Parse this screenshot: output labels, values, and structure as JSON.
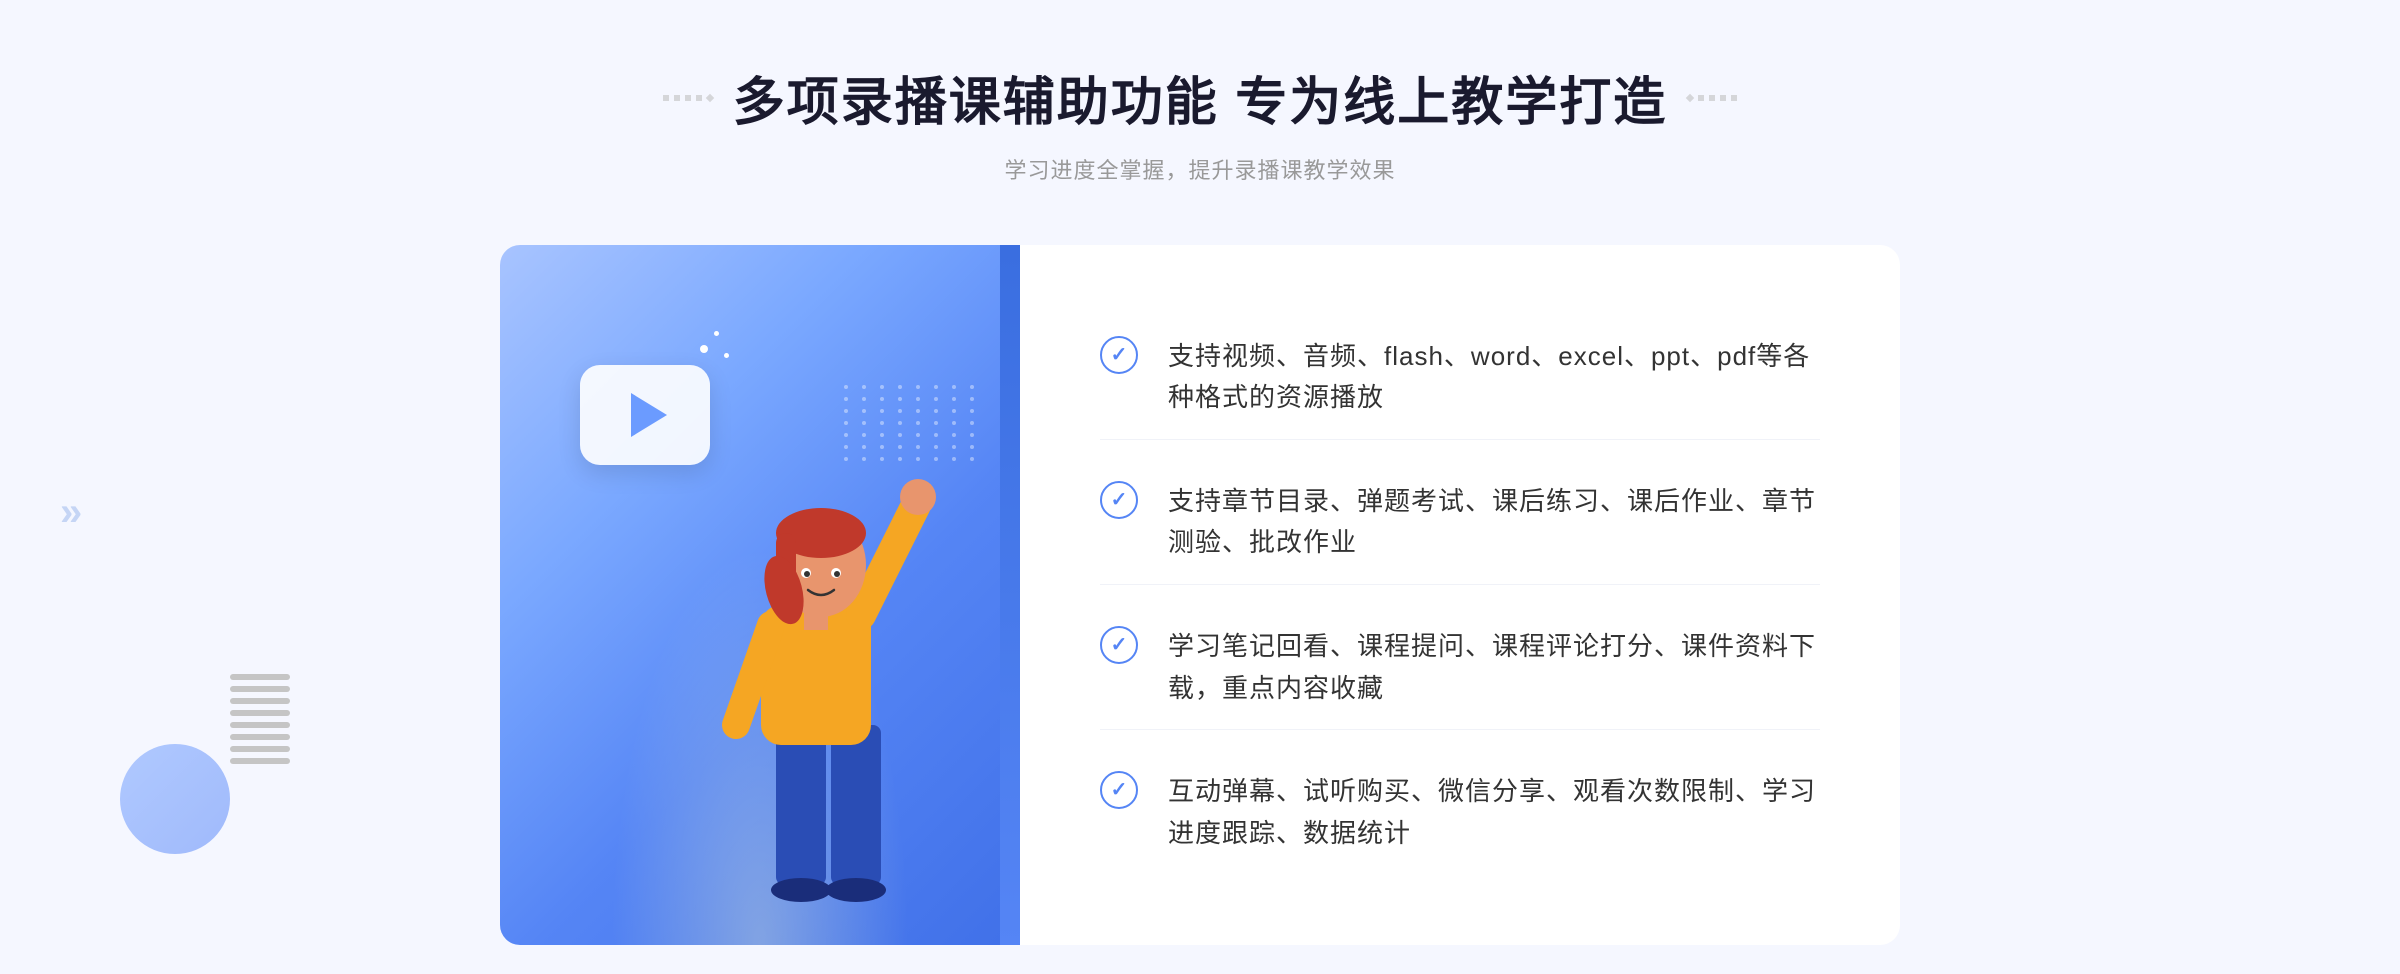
{
  "header": {
    "title": "多项录播课辅助功能 专为线上教学打造",
    "subtitle": "学习进度全掌握，提升录播课教学效果",
    "deco_left": "⁚",
    "deco_right": "⁚"
  },
  "features": [
    {
      "id": "feature-1",
      "text": "支持视频、音频、flash、word、excel、ppt、pdf等各种格式的资源播放"
    },
    {
      "id": "feature-2",
      "text": "支持章节目录、弹题考试、课后练习、课后作业、章节测验、批改作业"
    },
    {
      "id": "feature-3",
      "text": "学习笔记回看、课程提问、课程评论打分、课件资料下载，重点内容收藏"
    },
    {
      "id": "feature-4",
      "text": "互动弹幕、试听购买、微信分享、观看次数限制、学习进度跟踪、数据统计"
    }
  ],
  "colors": {
    "primary": "#5585f5",
    "light_blue": "#a8c4ff",
    "text_dark": "#1a1a2e",
    "text_sub": "#999999",
    "text_body": "#333333"
  }
}
